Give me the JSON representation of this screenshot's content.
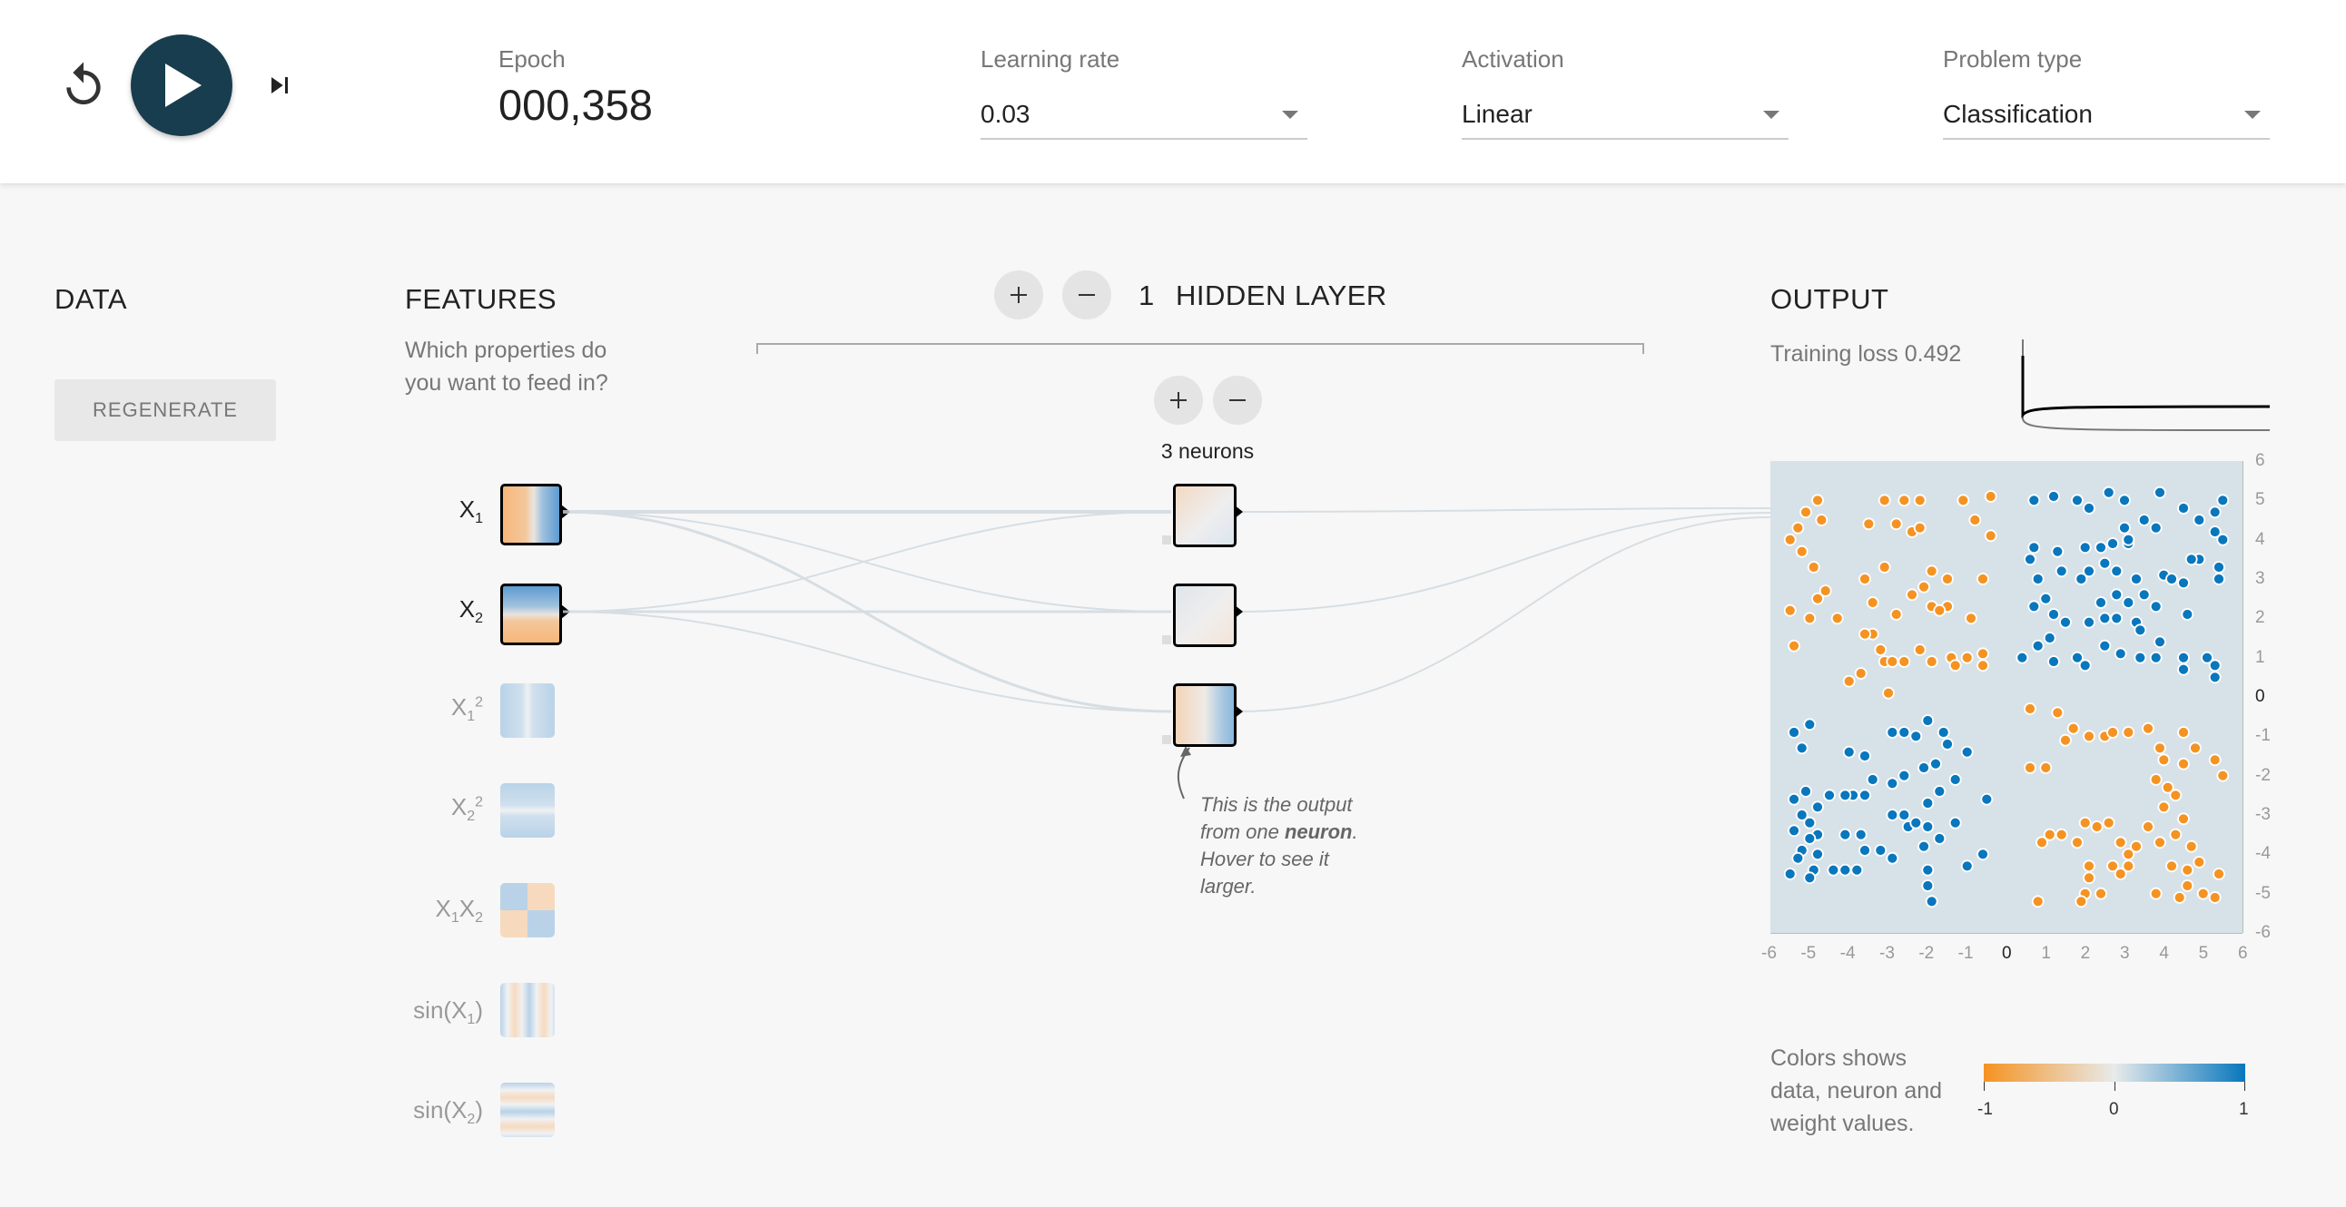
{
  "controls": {
    "epoch_label": "Epoch",
    "epoch_value": "000,358",
    "learning_rate_label": "Learning rate",
    "learning_rate_value": "0.03",
    "activation_label": "Activation",
    "activation_value": "Linear",
    "problem_type_label": "Problem type",
    "problem_type_value": "Classification"
  },
  "data_column": {
    "title": "DATA",
    "regenerate_label": "REGENERATE"
  },
  "features": {
    "title": "FEATURES",
    "subtitle_line1": "Which properties do",
    "subtitle_line2": "you want to feed in?",
    "items": [
      {
        "base": "X",
        "sub": "1",
        "sup": "",
        "tail": "",
        "active": true
      },
      {
        "base": "X",
        "sub": "2",
        "sup": "",
        "tail": "",
        "active": true
      },
      {
        "base": "X",
        "sub": "1",
        "sup": "2",
        "tail": "",
        "active": false
      },
      {
        "base": "X",
        "sub": "2",
        "sup": "2",
        "tail": "",
        "active": false
      },
      {
        "base": "X",
        "sub": "1",
        "sup": "",
        "tail": "X",
        "sub2": "2",
        "active": false
      },
      {
        "base": "sin(X",
        "sub": "1",
        "sup": "",
        "tail": ")",
        "active": false
      },
      {
        "base": "sin(X",
        "sub": "2",
        "sup": "",
        "tail": ")",
        "active": false
      }
    ]
  },
  "hidden": {
    "count": "1",
    "title": "HIDDEN LAYER",
    "neurons_label": "3 neurons",
    "note_line1": "This is the output",
    "note_line2a": "from one ",
    "note_bold": "neuron",
    "note_line2b": ".",
    "note_line3": "Hover to see it",
    "note_line4": "larger."
  },
  "output": {
    "title": "OUTPUT",
    "training_loss_label": "Training loss 0.492",
    "legend_line1": "Colors shows",
    "legend_line2": "data, neuron and",
    "legend_line3": "weight values.",
    "legend_min": "-1",
    "legend_mid": "0",
    "legend_max": "1"
  },
  "colors": {
    "positive": "#0877bd",
    "negative": "#f59322",
    "dark": "#183d4e"
  },
  "chart_data": {
    "type": "scatter",
    "xlim": [
      -6,
      6
    ],
    "ylim": [
      -6,
      6
    ],
    "x_ticks": [
      "-6",
      "-5",
      "-4",
      "-3",
      "-2",
      "-1",
      "0",
      "1",
      "2",
      "3",
      "4",
      "5",
      "6"
    ],
    "y_ticks": [
      "6",
      "5",
      "4",
      "3",
      "2",
      "1",
      "0",
      "-1",
      "-2",
      "-3",
      "-4",
      "-5",
      "-6"
    ],
    "series": [
      {
        "class": "orange",
        "points": [
          [
            -5.5,
            4.0
          ],
          [
            -5.3,
            4.3
          ],
          [
            -5.1,
            4.7
          ],
          [
            -4.8,
            5.0
          ],
          [
            -4.7,
            4.5
          ],
          [
            -5.2,
            3.7
          ],
          [
            -4.9,
            3.3
          ],
          [
            -4.6,
            2.7
          ],
          [
            -4.8,
            2.5
          ],
          [
            -5.5,
            2.2
          ],
          [
            -5.0,
            2.0
          ],
          [
            -4.3,
            2.0
          ],
          [
            -5.4,
            1.3
          ],
          [
            -3.6,
            3.0
          ],
          [
            -3.4,
            2.4
          ],
          [
            -3.1,
            3.3
          ],
          [
            -2.8,
            4.4
          ],
          [
            -2.4,
            4.2
          ],
          [
            -2.2,
            4.3
          ],
          [
            -2.6,
            5.0
          ],
          [
            -3.1,
            5.0
          ],
          [
            -3.5,
            4.4
          ],
          [
            -2.2,
            5.0
          ],
          [
            -1.9,
            3.2
          ],
          [
            -1.5,
            3.0
          ],
          [
            -2.1,
            2.8
          ],
          [
            -2.4,
            2.6
          ],
          [
            -1.9,
            2.3
          ],
          [
            -1.5,
            2.3
          ],
          [
            -1.7,
            2.2
          ],
          [
            -0.9,
            2.0
          ],
          [
            -0.6,
            3.0
          ],
          [
            -2.8,
            2.1
          ],
          [
            -3.4,
            1.6
          ],
          [
            -3.1,
            0.9
          ],
          [
            -3.7,
            0.6
          ],
          [
            -3.6,
            1.6
          ],
          [
            -3.2,
            1.2
          ],
          [
            -2.9,
            0.9
          ],
          [
            -2.6,
            0.9
          ],
          [
            -2.2,
            1.2
          ],
          [
            -1.9,
            0.9
          ],
          [
            -1.4,
            1.0
          ],
          [
            -1.3,
            0.8
          ],
          [
            -1.0,
            1.0
          ],
          [
            -0.6,
            0.8
          ],
          [
            -0.6,
            1.1
          ],
          [
            -1.1,
            5.0
          ],
          [
            -0.8,
            4.5
          ],
          [
            -0.4,
            5.1
          ],
          [
            -0.4,
            4.1
          ],
          [
            -4.0,
            0.4
          ],
          [
            -3.0,
            0.1
          ],
          [
            0.6,
            -0.3
          ],
          [
            1.3,
            -0.4
          ],
          [
            1.5,
            -1.1
          ],
          [
            1.7,
            -0.8
          ],
          [
            2.1,
            -1.0
          ],
          [
            2.5,
            -1.0
          ],
          [
            2.7,
            -0.9
          ],
          [
            3.1,
            -0.9
          ],
          [
            3.6,
            -0.8
          ],
          [
            3.9,
            -1.3
          ],
          [
            4.0,
            -1.6
          ],
          [
            4.5,
            -0.9
          ],
          [
            4.5,
            -1.7
          ],
          [
            4.8,
            -1.3
          ],
          [
            5.3,
            -1.6
          ],
          [
            5.5,
            -2.0
          ],
          [
            0.6,
            -1.8
          ],
          [
            1.0,
            -1.8
          ],
          [
            3.8,
            -2.1
          ],
          [
            4.1,
            -2.3
          ],
          [
            4.3,
            -2.5
          ],
          [
            4.0,
            -2.8
          ],
          [
            4.5,
            -3.1
          ],
          [
            3.9,
            -3.7
          ],
          [
            3.6,
            -3.3
          ],
          [
            2.6,
            -3.2
          ],
          [
            2.3,
            -3.3
          ],
          [
            2.0,
            -3.2
          ],
          [
            1.8,
            -3.7
          ],
          [
            1.4,
            -3.5
          ],
          [
            1.1,
            -3.5
          ],
          [
            0.9,
            -3.7
          ],
          [
            2.9,
            -3.7
          ],
          [
            3.3,
            -3.8
          ],
          [
            3.1,
            -4.0
          ],
          [
            2.7,
            -4.3
          ],
          [
            2.1,
            -4.3
          ],
          [
            2.1,
            -4.6
          ],
          [
            2.0,
            -5.0
          ],
          [
            1.9,
            -5.2
          ],
          [
            2.4,
            -5.0
          ],
          [
            3.1,
            -4.3
          ],
          [
            2.9,
            -4.5
          ],
          [
            4.3,
            -3.5
          ],
          [
            4.7,
            -3.8
          ],
          [
            4.9,
            -4.2
          ],
          [
            4.6,
            -4.4
          ],
          [
            4.6,
            -4.8
          ],
          [
            4.2,
            -4.3
          ],
          [
            5.4,
            -4.5
          ],
          [
            5.0,
            -5.0
          ],
          [
            4.4,
            -5.1
          ],
          [
            3.8,
            -5.0
          ],
          [
            0.8,
            -5.2
          ],
          [
            5.3,
            -5.1
          ]
        ]
      },
      {
        "class": "blue",
        "points": [
          [
            0.7,
            5.0
          ],
          [
            1.2,
            5.1
          ],
          [
            1.8,
            5.0
          ],
          [
            2.1,
            4.8
          ],
          [
            2.6,
            5.2
          ],
          [
            3.0,
            5.0
          ],
          [
            3.5,
            4.5
          ],
          [
            3.9,
            5.2
          ],
          [
            4.5,
            4.8
          ],
          [
            4.9,
            4.5
          ],
          [
            5.3,
            4.7
          ],
          [
            5.5,
            5.0
          ],
          [
            5.3,
            4.2
          ],
          [
            5.5,
            4.0
          ],
          [
            0.7,
            3.8
          ],
          [
            0.6,
            3.5
          ],
          [
            1.3,
            3.7
          ],
          [
            2.0,
            3.8
          ],
          [
            2.4,
            3.8
          ],
          [
            2.7,
            3.9
          ],
          [
            3.1,
            3.9
          ],
          [
            3.1,
            4.0
          ],
          [
            3.0,
            4.3
          ],
          [
            3.8,
            4.3
          ],
          [
            4.9,
            3.5
          ],
          [
            4.7,
            3.5
          ],
          [
            5.4,
            3.3
          ],
          [
            5.4,
            3.0
          ],
          [
            0.8,
            3.0
          ],
          [
            1.4,
            3.2
          ],
          [
            1.9,
            3.0
          ],
          [
            2.1,
            3.2
          ],
          [
            2.5,
            3.4
          ],
          [
            2.8,
            3.2
          ],
          [
            3.3,
            3.0
          ],
          [
            3.5,
            2.6
          ],
          [
            4.0,
            3.1
          ],
          [
            4.2,
            3.0
          ],
          [
            4.5,
            2.9
          ],
          [
            1.0,
            2.5
          ],
          [
            0.7,
            2.3
          ],
          [
            1.2,
            2.1
          ],
          [
            1.5,
            1.9
          ],
          [
            2.1,
            1.9
          ],
          [
            2.5,
            2.0
          ],
          [
            2.8,
            2.0
          ],
          [
            2.4,
            2.4
          ],
          [
            2.8,
            2.6
          ],
          [
            3.1,
            2.4
          ],
          [
            3.3,
            1.9
          ],
          [
            3.4,
            1.7
          ],
          [
            3.8,
            2.3
          ],
          [
            4.6,
            2.1
          ],
          [
            0.4,
            1.0
          ],
          [
            0.8,
            1.3
          ],
          [
            1.1,
            1.5
          ],
          [
            1.2,
            0.9
          ],
          [
            1.8,
            1.0
          ],
          [
            2.0,
            0.8
          ],
          [
            2.5,
            1.3
          ],
          [
            2.9,
            1.1
          ],
          [
            3.4,
            1.0
          ],
          [
            3.8,
            1.0
          ],
          [
            3.9,
            1.4
          ],
          [
            4.5,
            1.0
          ],
          [
            4.5,
            0.7
          ],
          [
            5.3,
            0.8
          ],
          [
            5.3,
            0.5
          ],
          [
            5.1,
            1.0
          ],
          [
            -5.4,
            -0.9
          ],
          [
            -5.2,
            -1.3
          ],
          [
            -5.0,
            -0.7
          ],
          [
            -4.0,
            -1.4
          ],
          [
            -3.6,
            -1.5
          ],
          [
            -2.9,
            -0.9
          ],
          [
            -2.6,
            -0.9
          ],
          [
            -2.3,
            -1.0
          ],
          [
            -2.0,
            -0.6
          ],
          [
            -1.6,
            -0.9
          ],
          [
            -1.5,
            -1.2
          ],
          [
            -1.0,
            -1.4
          ],
          [
            -1.3,
            -2.1
          ],
          [
            -1.8,
            -1.7
          ],
          [
            -2.1,
            -1.8
          ],
          [
            -2.6,
            -2.0
          ],
          [
            -2.9,
            -2.2
          ],
          [
            -3.4,
            -2.1
          ],
          [
            -3.6,
            -2.5
          ],
          [
            -3.9,
            -2.5
          ],
          [
            -4.1,
            -2.5
          ],
          [
            -4.5,
            -2.5
          ],
          [
            -5.1,
            -2.4
          ],
          [
            -5.4,
            -2.6
          ],
          [
            -4.8,
            -2.8
          ],
          [
            -5.2,
            -3.0
          ],
          [
            -5.0,
            -3.2
          ],
          [
            -5.4,
            -3.4
          ],
          [
            -4.8,
            -3.5
          ],
          [
            -5.0,
            -3.6
          ],
          [
            -5.2,
            -3.9
          ],
          [
            -5.3,
            -4.1
          ],
          [
            -4.8,
            -4.0
          ],
          [
            -4.9,
            -4.4
          ],
          [
            -5.0,
            -4.6
          ],
          [
            -5.5,
            -4.5
          ],
          [
            -4.4,
            -4.4
          ],
          [
            -4.1,
            -4.4
          ],
          [
            -3.8,
            -4.4
          ],
          [
            -4.1,
            -3.5
          ],
          [
            -3.7,
            -3.5
          ],
          [
            -3.6,
            -3.9
          ],
          [
            -3.2,
            -3.9
          ],
          [
            -2.9,
            -4.1
          ],
          [
            -2.9,
            -3.0
          ],
          [
            -2.6,
            -3.0
          ],
          [
            -2.5,
            -3.3
          ],
          [
            -2.3,
            -3.2
          ],
          [
            -2.0,
            -3.3
          ],
          [
            -1.7,
            -3.6
          ],
          [
            -2.0,
            -4.4
          ],
          [
            -2.0,
            -4.8
          ],
          [
            -1.9,
            -5.2
          ],
          [
            -2.1,
            -3.8
          ],
          [
            -1.3,
            -3.2
          ],
          [
            -1.0,
            -4.3
          ],
          [
            -0.6,
            -4.0
          ],
          [
            -0.5,
            -2.6
          ],
          [
            -1.7,
            -2.4
          ],
          [
            -2.0,
            -2.7
          ]
        ]
      }
    ]
  }
}
